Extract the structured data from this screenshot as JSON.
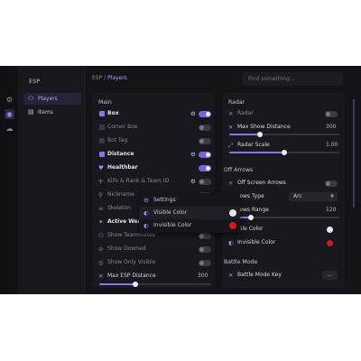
{
  "icons": {
    "rail": [
      "gear-icon",
      "eye-icon",
      "cloud-icon"
    ]
  },
  "sidebar": {
    "title": "ESP",
    "items": [
      {
        "label": "Players",
        "active": true,
        "icon": "users-icon"
      },
      {
        "label": "Items",
        "active": false,
        "icon": "items-icon"
      }
    ]
  },
  "breadcrumb": {
    "root": "ESP",
    "sep": "/",
    "current": "Players"
  },
  "search": {
    "placeholder": "Find something..."
  },
  "main_panel": {
    "title": "Main",
    "rows": [
      {
        "label": "Box",
        "checked": true,
        "gear": true,
        "toggle": true
      },
      {
        "label": "Corner Box",
        "checked": false,
        "toggle": false
      },
      {
        "label": "Bot Tag",
        "checked": false,
        "toggle": false
      },
      {
        "label": "Distance",
        "checked": true,
        "gear": true,
        "toggle": true
      },
      {
        "label": "Healthbar",
        "checked": true,
        "toggle": true
      },
      {
        "label": "Kills & Rank & Team ID",
        "checked": false,
        "gear": true,
        "toggle": false
      },
      {
        "label": "Nickname",
        "checked": false,
        "toggle": false
      },
      {
        "label": "Skeleton",
        "checked": false,
        "toggle": false
      },
      {
        "label": "Active Weap",
        "checked": true,
        "toggle": true
      },
      {
        "label": "Show Teammates",
        "checked": false,
        "toggle": false
      },
      {
        "label": "Show Downed",
        "checked": false,
        "toggle": false
      },
      {
        "label": "Show Only Visible",
        "checked": false,
        "toggle": false
      }
    ],
    "slider": {
      "label": "Max ESP Distance",
      "value": "300",
      "fraction": 0.32
    }
  },
  "radar_panel": {
    "title": "Radar",
    "radar_label": "Radar",
    "radar_on": false,
    "max_show": {
      "label": "Max Show Distance",
      "value": "300",
      "fraction": 0.28
    },
    "scale": {
      "label": "Radar Scale",
      "value": "1.00",
      "fraction": 0.5
    },
    "offarrows_title": "Off Arrows",
    "offscreen": {
      "label": "Off Screen Arrows",
      "on": false
    },
    "arrows_type": {
      "label": "rows Type",
      "value": "Arc"
    },
    "arrows_range": {
      "label": "rows Range",
      "value": "120",
      "fraction": 0.2
    },
    "visible_color": {
      "label": "ible Color",
      "color": "#e6e6e6"
    },
    "invisible_color": {
      "label": "Invisible Color",
      "color": "#d51818"
    },
    "battle_title": "Battle Mode",
    "battle_key": {
      "label": "Battle Mode Key",
      "value": "..."
    }
  },
  "context_menu": {
    "items": [
      {
        "label": "Settings",
        "icon": "settings-icon"
      },
      {
        "label": "Visible Color",
        "icon": "color-icon",
        "color": "#e6e6e6"
      },
      {
        "label": "Invisible Color",
        "icon": "color-icon",
        "color": "#d51818"
      }
    ]
  },
  "colors": {
    "accent": "#8e72ea",
    "background": "#131318",
    "panel": "#18181e"
  }
}
